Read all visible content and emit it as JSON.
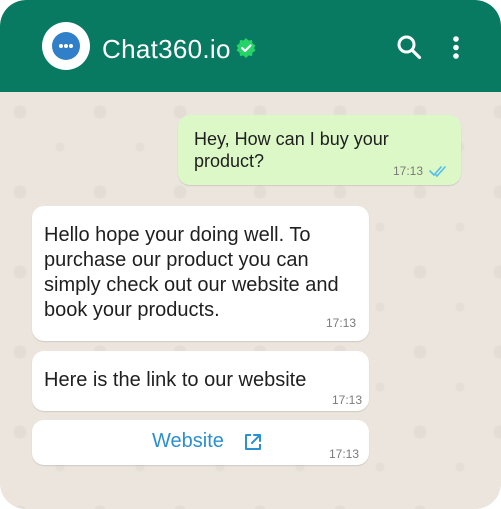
{
  "header": {
    "title": "Chat360.io",
    "color": "#097a62",
    "icons": [
      "chat-logo-icon",
      "verified-badge-icon",
      "search-icon",
      "more-vert-icon"
    ]
  },
  "messages": [
    {
      "direction": "outgoing",
      "text": "Hey, How can I buy your product?",
      "time": "17:13",
      "status": "read"
    },
    {
      "direction": "incoming",
      "text": "Hello hope your doing well. To purchase our product you can simply check out our website and book your products.",
      "time": "17:13"
    },
    {
      "direction": "incoming",
      "text": "Here is the link to our website",
      "time": "17:13"
    },
    {
      "direction": "incoming",
      "link_label": "Website",
      "time": "17:13"
    }
  ],
  "colors": {
    "outgoing_bubble": "#dcf8c6",
    "incoming_bubble": "#ffffff",
    "link": "#2b8fd0",
    "read_ticks": "#53bdeb"
  }
}
